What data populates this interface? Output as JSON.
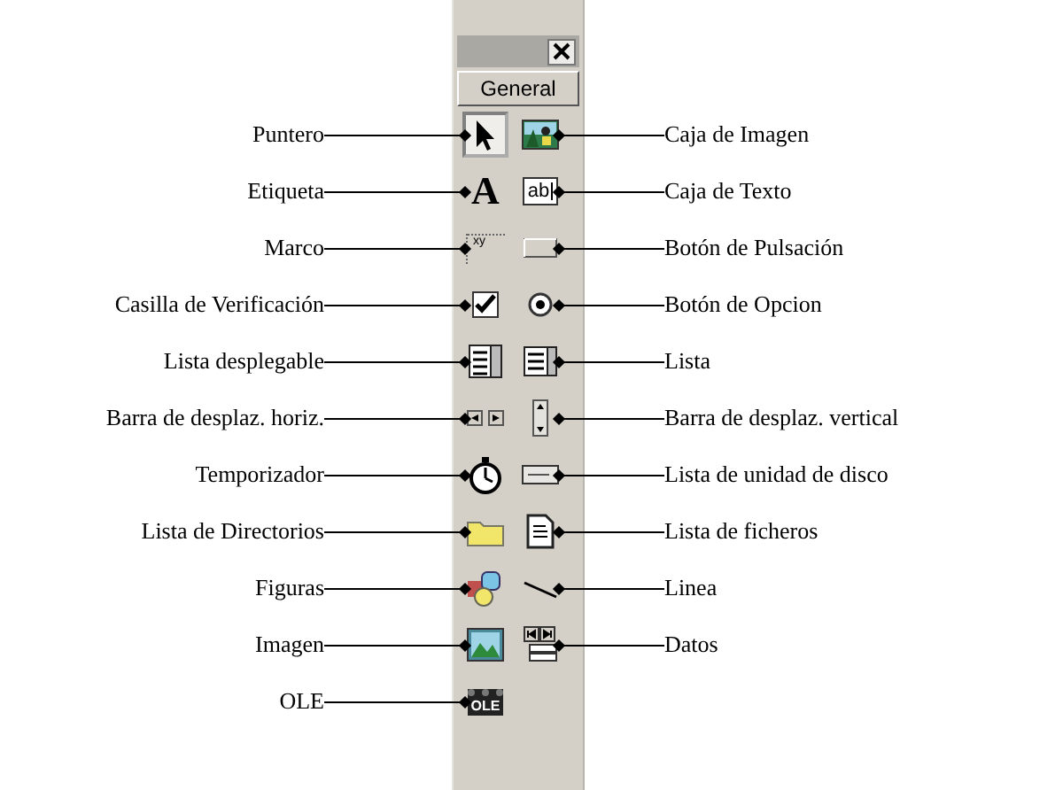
{
  "toolbox": {
    "tab": "General",
    "tools": [
      {
        "kind": "pointer",
        "label": "Puntero",
        "selected": true
      },
      {
        "kind": "imagebox",
        "label": "Caja de Imagen",
        "selected": false
      },
      {
        "kind": "label",
        "glyph": "A",
        "label": "Etiqueta",
        "selected": false
      },
      {
        "kind": "textbox",
        "glyph": "ab",
        "label": "Caja de Texto",
        "selected": false
      },
      {
        "kind": "frame",
        "glyph": "xy",
        "label": "Marco",
        "selected": false
      },
      {
        "kind": "command",
        "label": "Botón de Pulsación",
        "selected": false
      },
      {
        "kind": "checkbox",
        "label": "Casilla de Verificación",
        "selected": false
      },
      {
        "kind": "option",
        "label": "Botón de Opcion",
        "selected": false
      },
      {
        "kind": "combo",
        "label": "Lista desplegable",
        "selected": false
      },
      {
        "kind": "list",
        "label": "Lista",
        "selected": false
      },
      {
        "kind": "hscroll",
        "label": "Barra de desplaz. horiz.",
        "selected": false
      },
      {
        "kind": "vscroll",
        "label": "Barra de desplaz. vertical",
        "selected": false
      },
      {
        "kind": "timer",
        "label": "Temporizador",
        "selected": false
      },
      {
        "kind": "drive",
        "label": "Lista de unidad de disco",
        "selected": false
      },
      {
        "kind": "dir",
        "label": "Lista de Directorios",
        "selected": false
      },
      {
        "kind": "file",
        "label": "Lista de ficheros",
        "selected": false
      },
      {
        "kind": "shape",
        "label": "Figuras",
        "selected": false
      },
      {
        "kind": "line",
        "label": "Linea",
        "selected": false
      },
      {
        "kind": "image",
        "label": "Imagen",
        "selected": false
      },
      {
        "kind": "data",
        "label": "Datos",
        "selected": false
      },
      {
        "kind": "ole",
        "glyph": "OLE",
        "label": "OLE",
        "selected": false
      }
    ]
  }
}
